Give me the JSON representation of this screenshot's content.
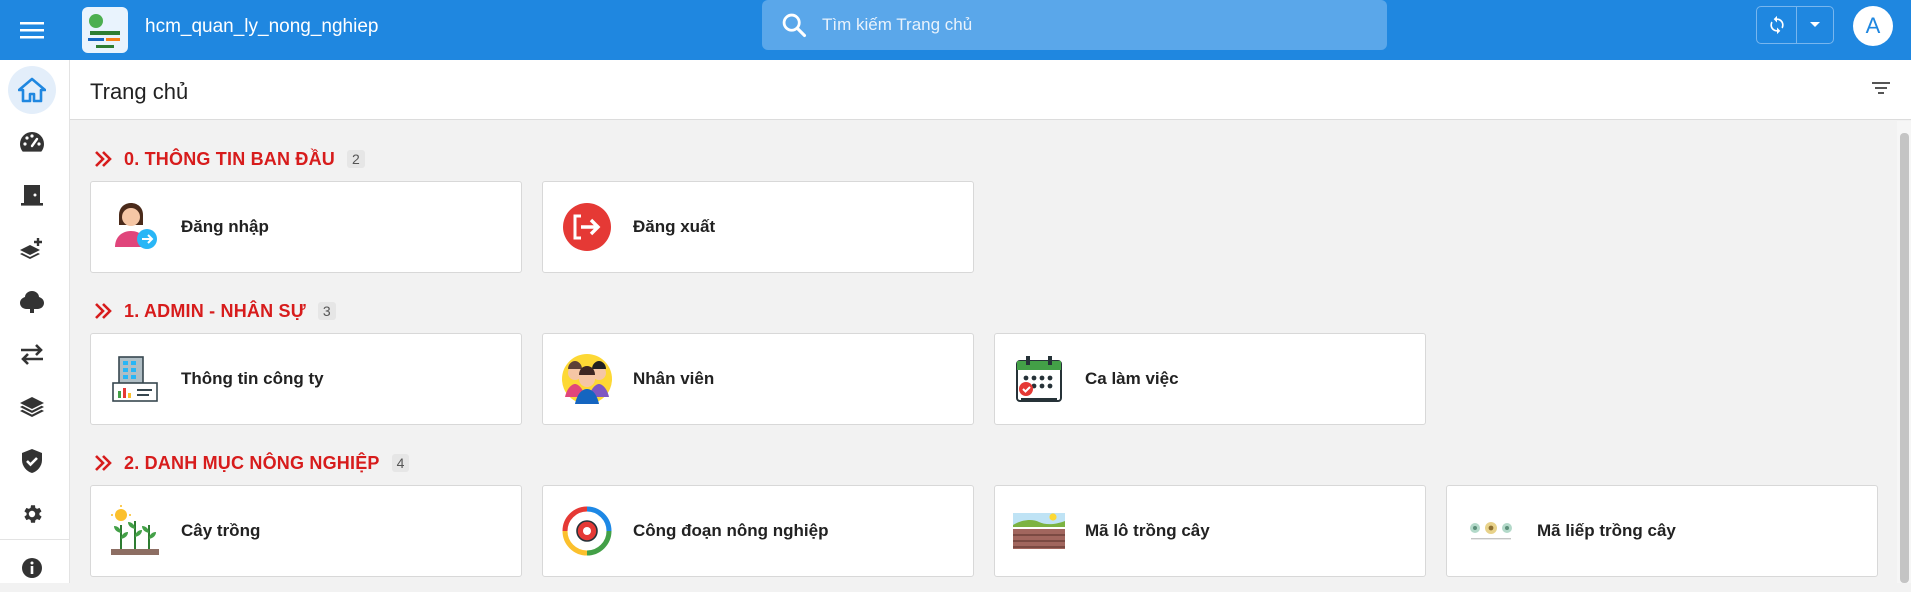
{
  "app": {
    "title": "hcm_quan_ly_nong_nghiep"
  },
  "search": {
    "placeholder": "Tìm kiếm Trang chủ"
  },
  "user": {
    "avatar_letter": "A"
  },
  "page": {
    "title": "Trang chủ"
  },
  "sidebar": {
    "items": [
      {
        "icon": "home-icon",
        "active": true
      },
      {
        "icon": "dashboard-icon"
      },
      {
        "icon": "door-exit-icon"
      },
      {
        "icon": "layers-add-icon"
      },
      {
        "icon": "tree-icon"
      },
      {
        "icon": "swap-icon"
      },
      {
        "icon": "layers-icon"
      },
      {
        "icon": "shield-check-icon"
      },
      {
        "icon": "gear-icon"
      },
      {
        "icon": "info-icon"
      }
    ]
  },
  "sections": [
    {
      "title": "0. THÔNG TIN BAN ĐẦU",
      "count": "2",
      "cards": [
        {
          "label": "Đăng nhập",
          "icon": "login-user-icon"
        },
        {
          "label": "Đăng xuất",
          "icon": "logout-icon"
        }
      ]
    },
    {
      "title": "1. ADMIN - NHÂN SỰ",
      "count": "3",
      "cards": [
        {
          "label": "Thông tin công ty",
          "icon": "company-building-icon"
        },
        {
          "label": "Nhân viên",
          "icon": "employees-icon"
        },
        {
          "label": "Ca làm việc",
          "icon": "calendar-shift-icon"
        }
      ]
    },
    {
      "title": "2. DANH MỤC NÔNG NGHIỆP",
      "count": "4",
      "cards": [
        {
          "label": "Cây trồng",
          "icon": "plants-icon"
        },
        {
          "label": "Công đoạn nông nghiệp",
          "icon": "process-cycle-icon"
        },
        {
          "label": "Mã lô trồng cây",
          "icon": "field-plot-icon"
        },
        {
          "label": "Mã liếp trồng cây",
          "icon": "plant-bed-icon"
        }
      ]
    }
  ],
  "colors": {
    "primary": "#1f87e0",
    "section_title": "#d71c1c"
  }
}
